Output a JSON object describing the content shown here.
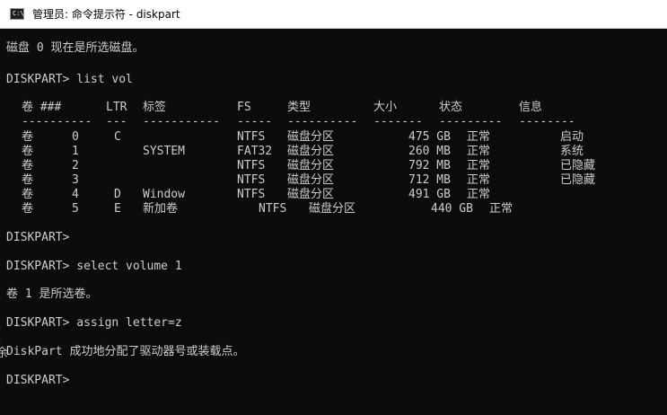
{
  "window": {
    "title": "管理员: 命令提示符 - diskpart",
    "icon_glyph": "C:\\",
    "icon_name": "cmd-icon"
  },
  "console": {
    "l_selected_disk": "磁盘 0 现在是所选磁盘。",
    "l_prompt_listvol": "DISKPART> list vol",
    "volume_table": {
      "headers": [
        "卷 ###",
        "LTR",
        "标签",
        "FS",
        "类型",
        "大小",
        "状态",
        "信息"
      ],
      "separators": [
        "----------",
        "---",
        "-----------",
        "-----",
        "----------",
        "-------",
        "---------",
        "--------"
      ],
      "rows": [
        [
          "卷",
          "0",
          "C",
          "",
          "NTFS",
          "磁盘分区",
          "475 GB",
          "正常",
          "启动"
        ],
        [
          "卷",
          "1",
          "",
          "SYSTEM",
          "FAT32",
          "磁盘分区",
          "260 MB",
          "正常",
          "系统"
        ],
        [
          "卷",
          "2",
          "",
          "",
          "NTFS",
          "磁盘分区",
          "792 MB",
          "正常",
          "已隐藏"
        ],
        [
          "卷",
          "3",
          "",
          "",
          "NTFS",
          "磁盘分区",
          "712 MB",
          "正常",
          "已隐藏"
        ],
        [
          "卷",
          "4",
          "D",
          "Window",
          "NTFS",
          "磁盘分区",
          "491 GB",
          "正常",
          ""
        ],
        [
          "卷",
          "5",
          "E",
          "新加卷",
          "NTFS",
          "磁盘分区",
          "440 GB",
          "正常",
          ""
        ]
      ]
    },
    "l_prompt_blank1": "DISKPART>",
    "l_prompt_select": "DISKPART> select volume 1",
    "l_selected_vol": "卷 1 是所选卷。",
    "l_prompt_assign": "DISKPART> assign letter=z",
    "l_assign_result": "DiskPart 成功地分配了驱动器号或装载点。",
    "l_prompt_blank2": "DISKPART>",
    "stray_glyphs": [
      "\\",
      "\\",
      "\\",
      "余"
    ]
  },
  "colors": {
    "console_bg": "#0c0c0c",
    "console_fg": "#cccccc",
    "titlebar_bg": "#ffffff"
  }
}
